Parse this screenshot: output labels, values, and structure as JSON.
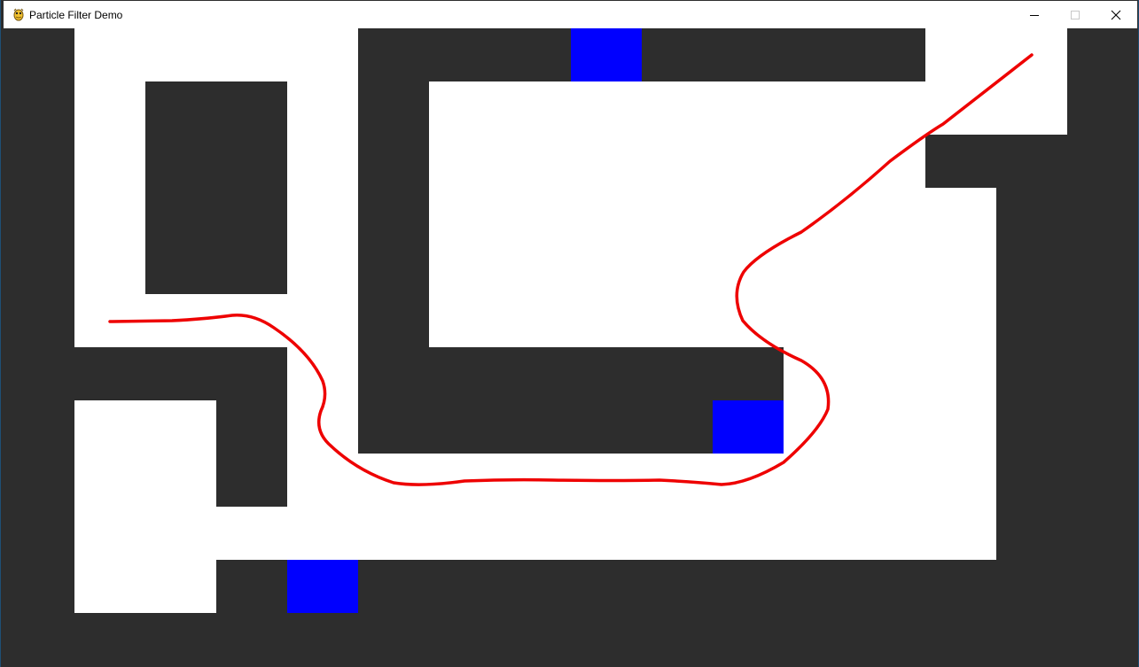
{
  "window": {
    "title": "Particle Filter Demo",
    "icon": "pygame-snake-icon",
    "controls": {
      "minimize_icon": "minimize-icon",
      "maximize_icon": "maximize-icon",
      "close_icon": "close-icon"
    }
  },
  "colors": {
    "wall": "#2d2d2d",
    "floor": "#ffffff",
    "beacon": "#0000ff",
    "path": "#ee0000"
  }
}
